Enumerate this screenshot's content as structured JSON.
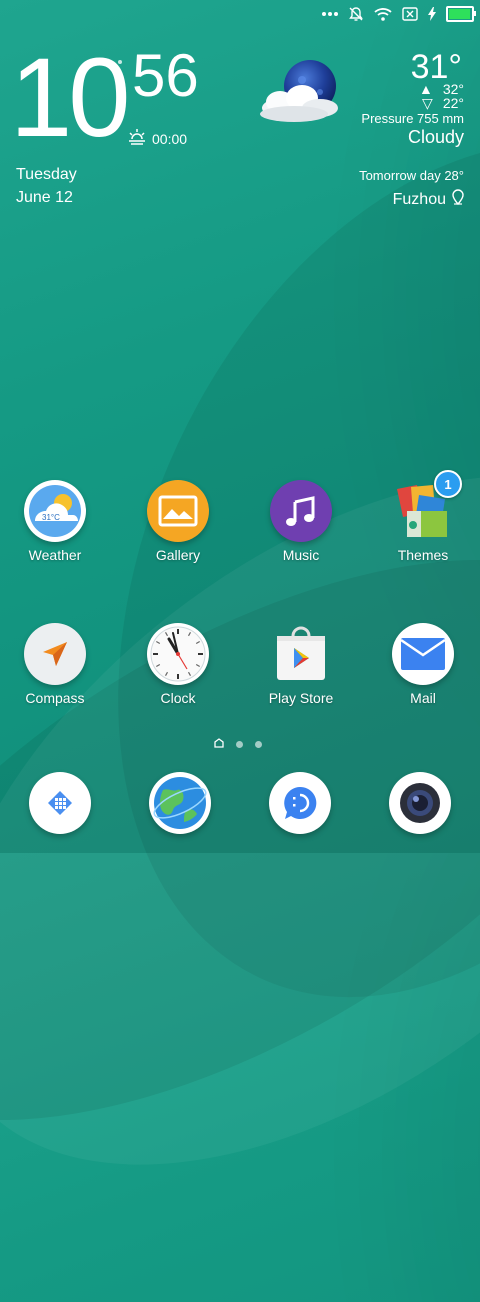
{
  "status_bar": {
    "icons": [
      "more-dots-icon",
      "notifications-muted-icon",
      "wifi-icon",
      "no-sim-icon",
      "charging-bolt-icon",
      "battery-icon"
    ],
    "battery_color": "#2ee05b"
  },
  "clock": {
    "hour": "10",
    "minute": "56",
    "alarm_time": "00:00",
    "day": "Tuesday",
    "date": "June 12"
  },
  "weather": {
    "temperature": "31°",
    "high": "32°",
    "low": "22°",
    "pressure": "Pressure 755 mm",
    "condition": "Cloudy",
    "tomorrow": "Tomorrow day 28°",
    "city": "Fuzhou"
  },
  "apps": [
    {
      "label": "Weather",
      "icon": "weather-icon",
      "badge_text": "31°C"
    },
    {
      "label": "Gallery",
      "icon": "gallery-icon"
    },
    {
      "label": "Music",
      "icon": "music-icon"
    },
    {
      "label": "Themes",
      "icon": "themes-icon",
      "badge": "1"
    },
    {
      "label": "Compass",
      "icon": "compass-icon"
    },
    {
      "label": "Clock",
      "icon": "clock-icon"
    },
    {
      "label": "Play Store",
      "icon": "play-store-icon"
    },
    {
      "label": "Mail",
      "icon": "mail-icon"
    }
  ],
  "dock": [
    {
      "icon": "phone-icon"
    },
    {
      "icon": "browser-icon"
    },
    {
      "icon": "messages-icon"
    },
    {
      "icon": "camera-icon"
    }
  ],
  "page_indicator": {
    "pages": 3,
    "current": 0
  },
  "colors": {
    "wallpaper": "#16a08a",
    "gallery": "#f5a623",
    "music": "#6f3fb0",
    "mail": "#3b82f0",
    "badge": "#2b9df0"
  }
}
